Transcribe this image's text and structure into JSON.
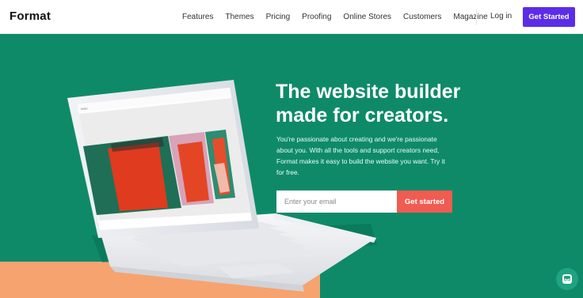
{
  "brand": {
    "name": "Format"
  },
  "nav": {
    "links": [
      "Features",
      "Themes",
      "Pricing",
      "Proofing",
      "Online Stores",
      "Customers",
      "Magazine"
    ],
    "login": "Log in",
    "cta": "Get Started"
  },
  "hero": {
    "title_line1": "The website builder",
    "title_line2": "made for creators.",
    "subtitle": "You're passionate about creating and we're passionate about you. With all the tools and support creators need, Format makes it easy to build the website you want. Try it for free.",
    "email_placeholder": "Enter your email",
    "button": "Get started"
  },
  "laptop_screen": {
    "site_title": "Mailys"
  },
  "colors": {
    "hero_bg": "#0f8a69",
    "accent_purple": "#5c2de8",
    "cta_red": "#f05b52",
    "peach": "#f6a36f"
  }
}
